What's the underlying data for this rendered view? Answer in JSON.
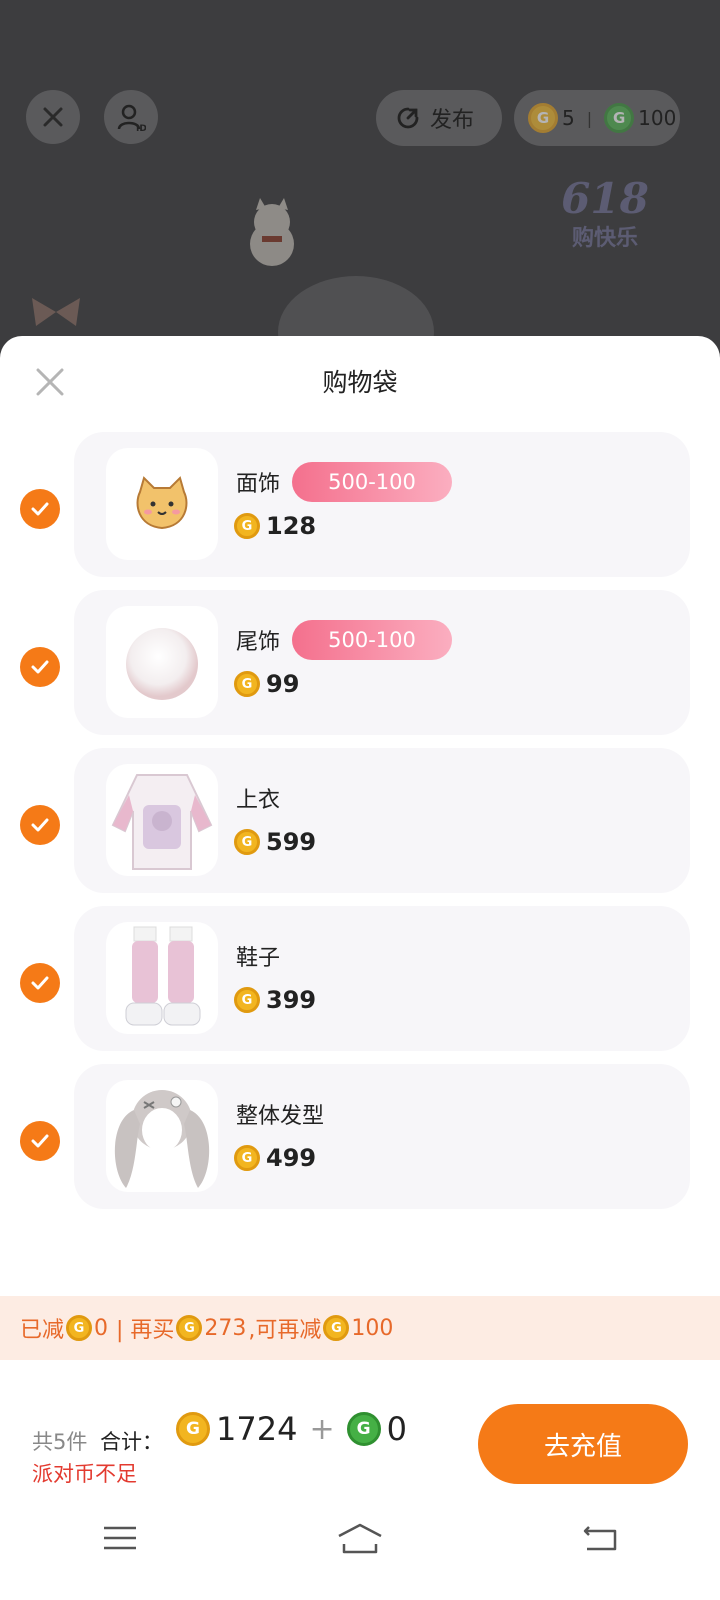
{
  "topbar": {
    "publish_label": "发布",
    "gold_balance": "5",
    "green_balance": "100"
  },
  "festival": {
    "big": "618",
    "small": "购快乐"
  },
  "sheet": {
    "title": "购物袋",
    "items": [
      {
        "name": "面饰",
        "promo": "500-100",
        "price": "128"
      },
      {
        "name": "尾饰",
        "promo": "500-100",
        "price": "99"
      },
      {
        "name": "上衣",
        "price": "599"
      },
      {
        "name": "鞋子",
        "price": "399"
      },
      {
        "name": "整体发型",
        "price": "499"
      }
    ],
    "discount": {
      "reduced_label": "已减",
      "reduced_value": "0",
      "buy_more_label": "| 再买",
      "buy_more_value": "273",
      "more_reduce_label": ",可再减",
      "more_reduce_value": "100"
    },
    "footer": {
      "count": "共5件",
      "total_label": "合计：",
      "gold_total": "1724",
      "plus": "+",
      "green_total": "0",
      "warning": "派对币不足",
      "recharge_label": "去充值"
    }
  },
  "colors": {
    "accent": "#f57a17",
    "promo": "#f4708d",
    "warning": "#e33a2f",
    "gold_coin": "#f2b520",
    "green_coin": "#45b045"
  }
}
